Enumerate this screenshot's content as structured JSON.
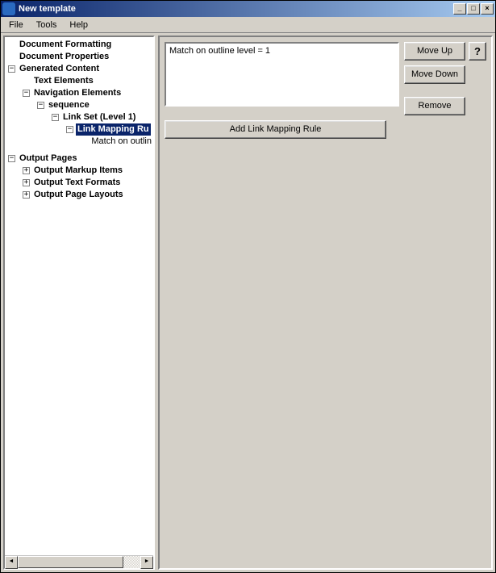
{
  "window": {
    "title": "New template",
    "controls": {
      "min": "_",
      "max": "□",
      "close": "×"
    }
  },
  "menu": {
    "file": "File",
    "tools": "Tools",
    "help": "Help"
  },
  "tree": {
    "doc_formatting": "Document Formatting",
    "doc_properties": "Document Properties",
    "generated_content": "Generated Content",
    "text_elements": "Text Elements",
    "navigation_elements": "Navigation Elements",
    "sequence": "sequence",
    "link_set": "Link Set (Level 1)",
    "link_mapping_rules": "Link Mapping Ru",
    "match_outline": "Match on outlin",
    "output_pages": "Output Pages",
    "output_markup_items": "Output Markup Items",
    "output_text_formats": "Output Text Formats",
    "output_page_layouts": "Output Page Layouts"
  },
  "list": {
    "items": [
      "Match on outline level = 1"
    ]
  },
  "buttons": {
    "move_up": "Move Up",
    "move_down": "Move Down",
    "remove": "Remove",
    "help": "?",
    "add_rule": "Add Link Mapping Rule"
  }
}
